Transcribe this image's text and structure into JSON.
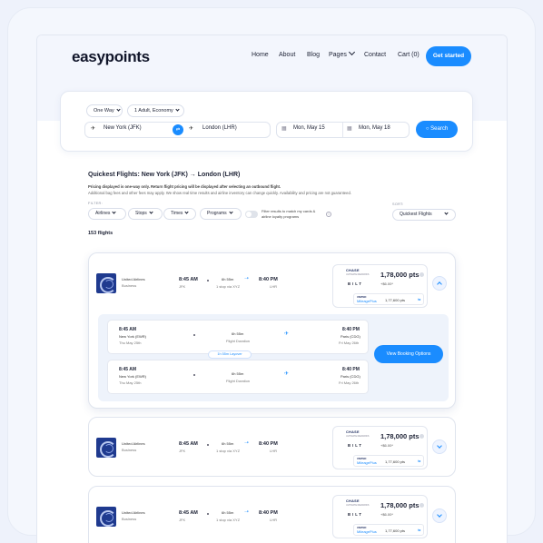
{
  "brand": "easypoints",
  "nav": {
    "home": "Home",
    "about": "About",
    "blog": "Blog",
    "pages": "Pages",
    "contact": "Contact",
    "cart": "Cart (0)",
    "cta": "Get started"
  },
  "search": {
    "trip_type": "One Way",
    "passengers": "1 Adult, Economy",
    "from": "New York (JFK)",
    "to": "London (LHR)",
    "depart_date": "Mon, May 15",
    "return_date": "Mon, May 18",
    "button": "Search"
  },
  "results": {
    "title": "Quickest Flights:  New York (JFK) → London (LHR)",
    "note_pricing": "Pricing displayed is one-way only. Return flight pricing will be displayed after selecting an outbound flight.",
    "note_fees": "Additional bag fees and other fees may apply. We show real time results and airline inventory can change quickly. Availability and pricing are not guaranteed.",
    "filter_label": "FILTER:",
    "sort_label": "SORT:",
    "filters": [
      "Airlines",
      "Stops",
      "Times",
      "Programs"
    ],
    "toggle_text": "Filter results to match my cards & airline loyalty programs",
    "sort_value": "Quickest Flights",
    "count": "153 flights"
  },
  "flights": [
    {
      "airline": "United Airlines",
      "cabin": "Business",
      "depart_time": "8:45 AM",
      "depart_code": "JFK",
      "duration": "6h 55m",
      "stops": "1 stop via XYZ",
      "arrive_time": "8:40 PM",
      "arrive_code": "LHR",
      "card_brand": "CHASE",
      "card_sub": "ULTIMATE REWARDS",
      "bilt": "BILT",
      "points": "1,78,000 pts",
      "fee": "+$6.00*",
      "program_top": "UNITED",
      "program_name": "MileagePlus",
      "program_points": "1,77,600 pts"
    },
    {
      "airline": "United Airlines",
      "cabin": "Business",
      "depart_time": "8:45 AM",
      "depart_code": "JFK",
      "duration": "6h 55m",
      "stops": "1 stop via XYZ",
      "arrive_time": "8:40 PM",
      "arrive_code": "LHR",
      "card_brand": "CHASE",
      "card_sub": "ULTIMATE REWARDS",
      "bilt": "BILT",
      "points": "1,78,000 pts",
      "fee": "+$6.00*",
      "program_top": "UNITED",
      "program_name": "MileagePlus",
      "program_points": "1,77,600 pts"
    },
    {
      "airline": "United Airlines",
      "cabin": "Business",
      "depart_time": "8:45 AM",
      "depart_code": "JFK",
      "duration": "6h 55m",
      "stops": "1 stop via XYZ",
      "arrive_time": "8:40 PM",
      "arrive_code": "LHR",
      "card_brand": "CHASE",
      "card_sub": "ULTIMATE REWARDS",
      "bilt": "BILT",
      "points": "1,78,000 pts",
      "fee": "+$6.00*",
      "program_top": "UNITED",
      "program_name": "MileagePlus",
      "program_points": "1,77,600 pts"
    }
  ],
  "details": {
    "legs": [
      {
        "dep_time": "8:45 AM",
        "dep_airport": "New York (EWR)",
        "dep_date": "Thu May 25th",
        "duration": "6h 55m",
        "duration_label": "Flight Duration",
        "arr_time": "8:40 PM",
        "arr_airport": "Paris (CDG)",
        "arr_date": "Fri May 26th"
      },
      {
        "dep_time": "8:45 AM",
        "dep_airport": "New York (EWR)",
        "dep_date": "Thu May 25th",
        "duration": "6h 55m",
        "duration_label": "Flight Duration",
        "arr_time": "8:40 PM",
        "arr_airport": "Paris (CDG)",
        "arr_date": "Fri May 26th"
      }
    ],
    "layover": "1h 55m Layover",
    "booking_button": "View Booking Options"
  },
  "colors": {
    "accent": "#1a8cff",
    "airline_logo": "#1f3a8f"
  },
  "icons": {
    "plane": "plane-icon",
    "calendar": "calendar-icon",
    "swap": "swap-icon",
    "search": "search-icon"
  }
}
